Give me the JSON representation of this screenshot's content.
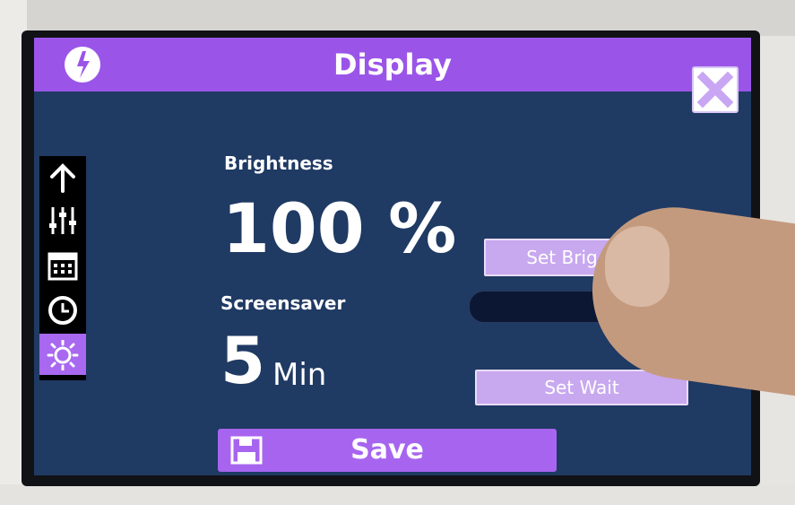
{
  "titlebar": {
    "title": "Display",
    "logo": "app-logo-icon",
    "close": "close-icon"
  },
  "sidebar": {
    "items": [
      {
        "icon": "arrow-up-icon",
        "active": false
      },
      {
        "icon": "sliders-icon",
        "active": false
      },
      {
        "icon": "calendar-icon",
        "active": false
      },
      {
        "icon": "clock-icon",
        "active": false
      },
      {
        "icon": "sun-icon",
        "active": true
      }
    ]
  },
  "brightness": {
    "label": "Brightness",
    "value": "100 %",
    "button": "Set Brig"
  },
  "screensaver": {
    "label": "Screensaver",
    "value": "5",
    "unit": "Min",
    "button": "Set Wait"
  },
  "save": {
    "label": "Save",
    "icon": "floppy-disk-icon"
  },
  "colors": {
    "titlebar": "#9a55e8",
    "screen": "#1f3a63",
    "accent": "#a868f0",
    "button": "#c8a8ef"
  }
}
